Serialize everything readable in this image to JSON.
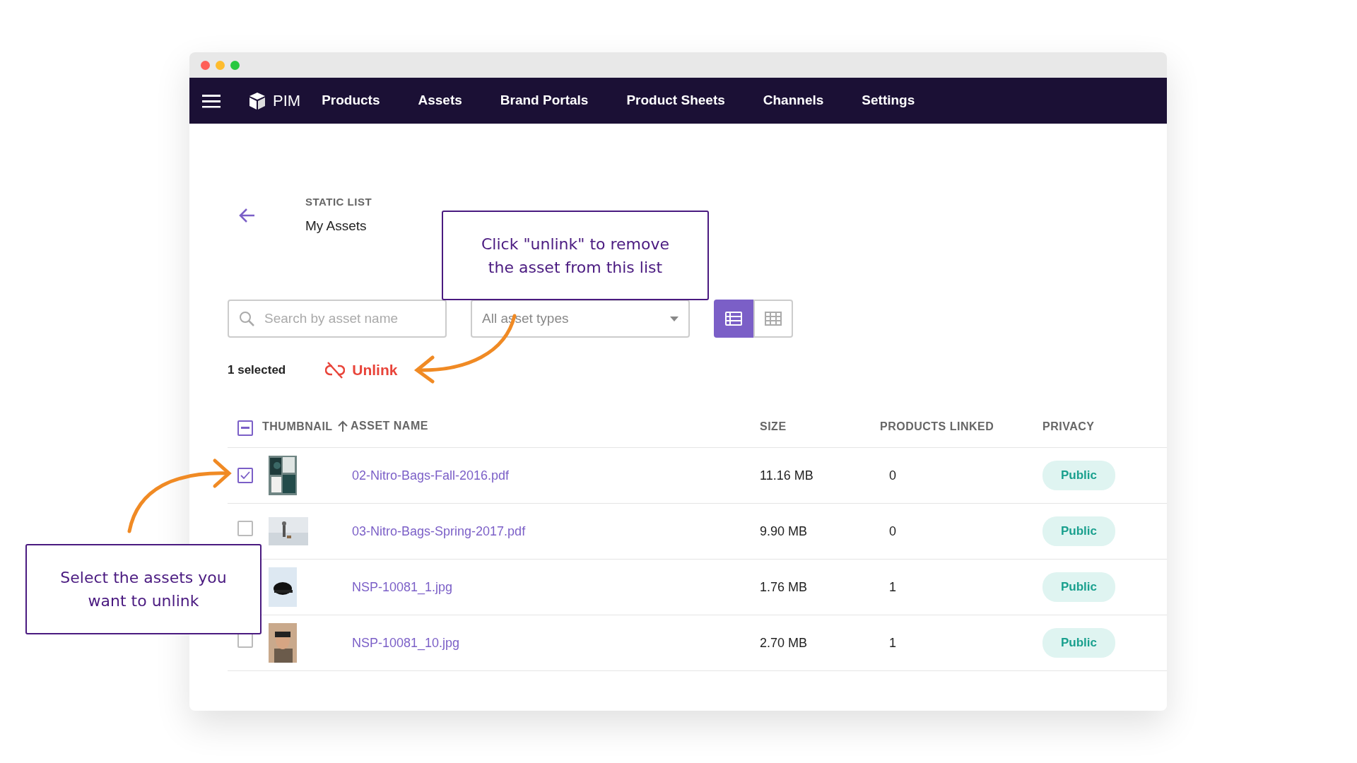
{
  "navbar": {
    "brand": "PIM",
    "items": [
      "Products",
      "Assets",
      "Brand Portals",
      "Product Sheets",
      "Channels",
      "Settings"
    ]
  },
  "header": {
    "eyebrow": "STATIC LIST",
    "title": "My Assets"
  },
  "search": {
    "placeholder": "Search by asset name"
  },
  "filter": {
    "value": "All asset types"
  },
  "view_toggle": [
    {
      "kind": "list",
      "selected": true
    },
    {
      "kind": "grid",
      "selected": false
    }
  ],
  "selection": {
    "count": "1 selected",
    "action": "Unlink"
  },
  "table": {
    "all_checkbox": {
      "indeterminate": true
    },
    "columns": [
      "THUMBNAIL",
      "ASSET NAME",
      "SIZE",
      "PRODUCTS LINKED",
      "PRIVACY"
    ],
    "rows": [
      {
        "selected": true,
        "name": "02-Nitro-Bags-Fall-2016.pdf",
        "size": "11.16 MB",
        "products_linked": "0",
        "privacy": "Public"
      },
      {
        "selected": false,
        "name": "03-Nitro-Bags-Spring-2017.pdf",
        "size": "9.90 MB",
        "products_linked": "0",
        "privacy": "Public"
      },
      {
        "name": "NSP-10081_1.jpg",
        "size": "1.76 MB",
        "products_linked": "1",
        "privacy": "Public"
      },
      {
        "selected": false,
        "name": "NSP-10081_10.jpg",
        "size": "2.70 MB",
        "products_linked": "1",
        "privacy": "Public"
      }
    ]
  },
  "callouts": [
    {
      "text": "Click \"unlink\" to remove the asset from this list"
    },
    {
      "text": "Select the assets you want to unlink"
    }
  ]
}
